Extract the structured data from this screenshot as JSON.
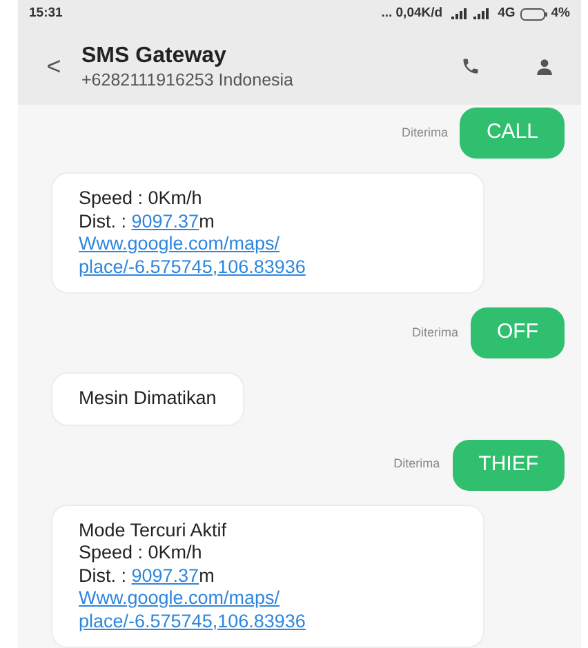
{
  "status_bar": {
    "time": "15:31",
    "network_speed": "... 0,04K/d",
    "network_type": "4G",
    "battery": "4%"
  },
  "header": {
    "back": "<",
    "title": "SMS Gateway",
    "subtitle": "+6282111916253 Indonesia"
  },
  "messages": [
    {
      "kind": "sent",
      "status": "Diterima",
      "text": "CALL"
    },
    {
      "kind": "received",
      "lines": [
        [
          {
            "kind": "text",
            "text": "Speed : 0Km/h"
          }
        ],
        [
          {
            "kind": "text",
            "text": "Dist. : "
          },
          {
            "kind": "link",
            "text": "9097.37"
          },
          {
            "kind": "text",
            "text": "m"
          }
        ],
        [
          {
            "kind": "link",
            "text": "Www.google.com/maps/"
          }
        ],
        [
          {
            "kind": "link",
            "text": "place/-6.575745,106.83936"
          }
        ]
      ]
    },
    {
      "kind": "sent",
      "status": "Diterima",
      "text": "OFF"
    },
    {
      "kind": "received",
      "lines": [
        [
          {
            "kind": "text",
            "text": "Mesin Dimatikan"
          }
        ]
      ]
    },
    {
      "kind": "sent",
      "status": "Diterima",
      "text": "THIEF"
    },
    {
      "kind": "received",
      "lines": [
        [
          {
            "kind": "text",
            "text": "Mode Tercuri Aktif"
          }
        ],
        [
          {
            "kind": "text",
            "text": "Speed : 0Km/h"
          }
        ],
        [
          {
            "kind": "text",
            "text": "Dist. : "
          },
          {
            "kind": "link",
            "text": "9097.37"
          },
          {
            "kind": "text",
            "text": "m"
          }
        ],
        [
          {
            "kind": "link",
            "text": "Www.google.com/maps/"
          }
        ],
        [
          {
            "kind": "link",
            "text": "place/-6.575745,106.83936"
          }
        ]
      ]
    }
  ]
}
